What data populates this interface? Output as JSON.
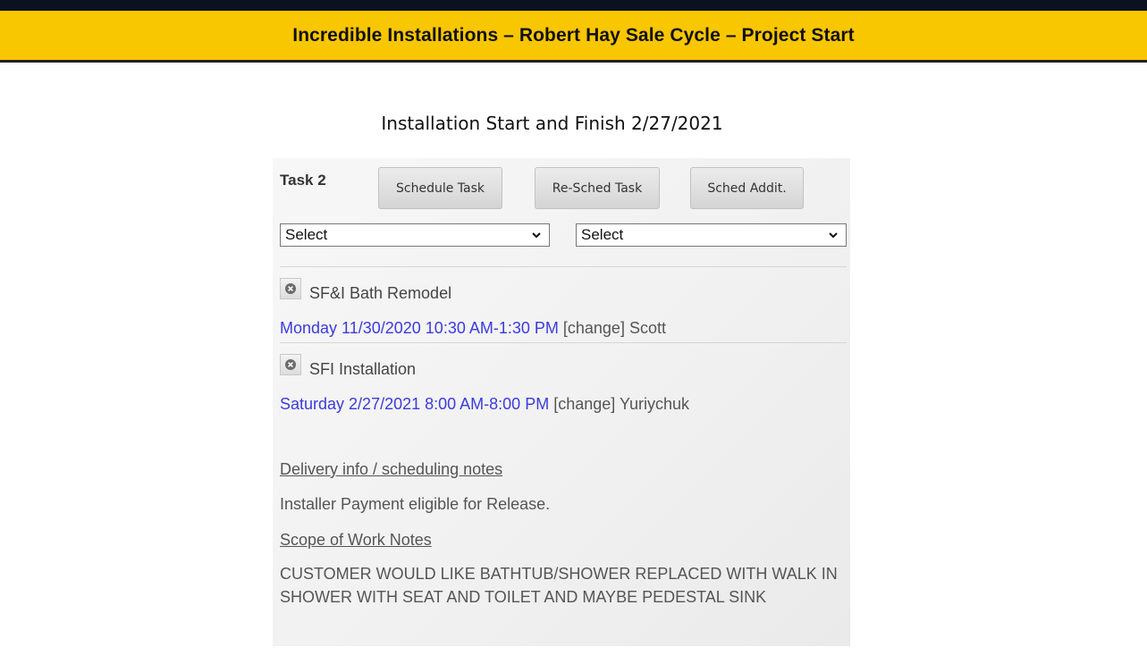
{
  "banner": {
    "title": "Incredible Installations – Robert Hay Sale Cycle – Project Start"
  },
  "subtitle": "Installation Start and Finish 2/27/2021",
  "task": {
    "label": "Task 2",
    "buttons": {
      "schedule": "Schedule Task",
      "resched": "Re-Sched Task",
      "sched_addit": "Sched Addit."
    },
    "select1": {
      "value": "Select"
    },
    "select2": {
      "value": "Select"
    },
    "items": [
      {
        "name": "SF&I Bath Remodel",
        "datetime": "Monday 11/30/2020 10:30 AM-1:30 PM",
        "change": "[change]",
        "assignee": "Scott"
      },
      {
        "name": "SFI Installation",
        "datetime": "Saturday 2/27/2021 8:00 AM-8:00 PM",
        "change": "[change]",
        "assignee": "Yuriychuk"
      }
    ]
  },
  "notes": {
    "delivery_link": "Delivery info / scheduling notes",
    "delivery_text": "Installer Payment eligible for Release.",
    "scope_link": "Scope of Work Notes",
    "scope_text": "CUSTOMER WOULD LIKE BATHTUB/SHOWER REPLACED WITH WALK IN SHOWER WITH SEAT AND TOILET AND MAYBE PEDESTAL SINK"
  },
  "icons": {
    "remove": "remove-circle-icon",
    "dropdown": "chevron-down-icon"
  }
}
